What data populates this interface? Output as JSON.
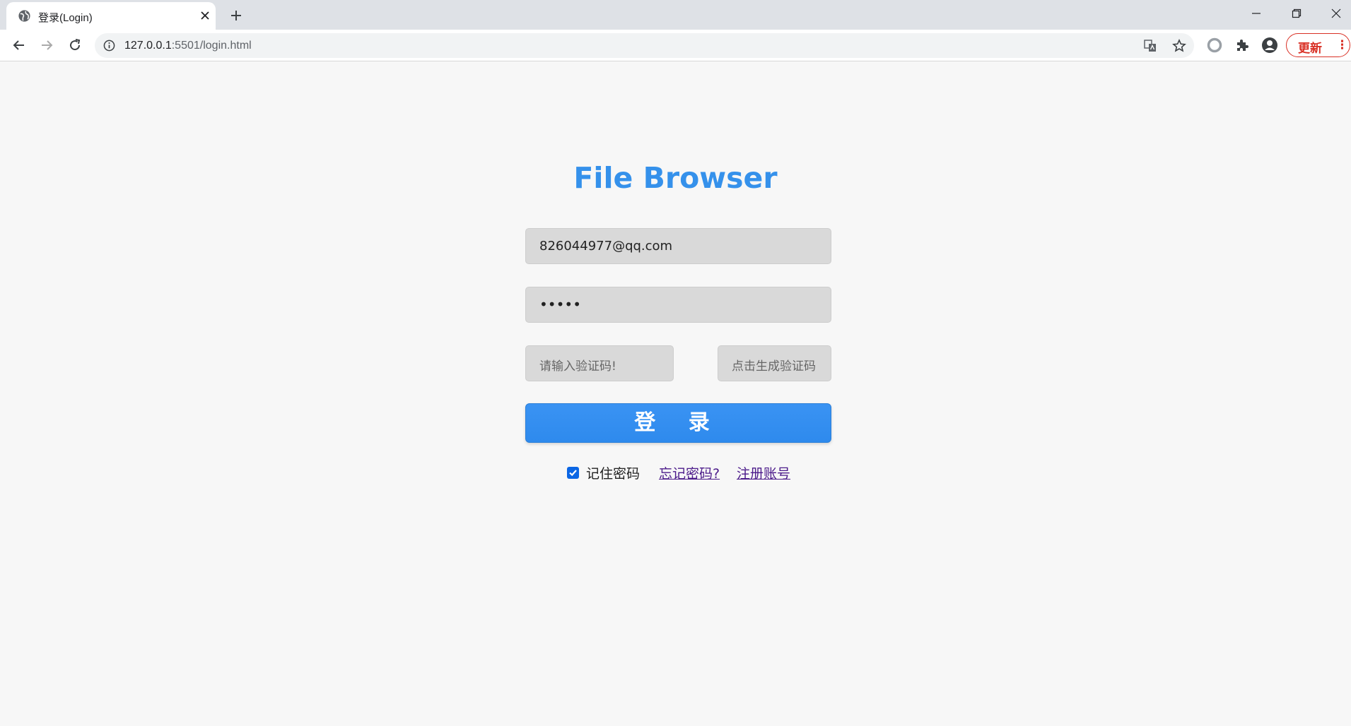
{
  "browser": {
    "tab_title": "登录(Login)",
    "url_host": "127.0.0.1",
    "url_rest": ":5501/login.html",
    "update_label": "更新",
    "menu_dots": "⋮"
  },
  "login": {
    "title": "File Browser",
    "email_value": "826044977@qq.com",
    "password_value": "•••••",
    "captcha_placeholder": "请输入验证码!",
    "captcha_button": "点击生成验证码",
    "submit_label": "登 录",
    "remember_label": "记住密码",
    "remember_checked": true,
    "forgot_link": "忘记密码? ",
    "register_link": "注册账号"
  },
  "colors": {
    "title": "#3591eb",
    "button": "#2e8aed",
    "link": "#4b1a8a",
    "update": "#d93025"
  },
  "icons": [
    "globe-icon",
    "close-icon",
    "plus-icon",
    "minimize-icon",
    "restore-icon",
    "back-icon",
    "forward-icon",
    "reload-icon",
    "info-icon",
    "translate-icon",
    "star-icon",
    "extension-circle-icon",
    "puzzle-icon",
    "account-icon"
  ]
}
